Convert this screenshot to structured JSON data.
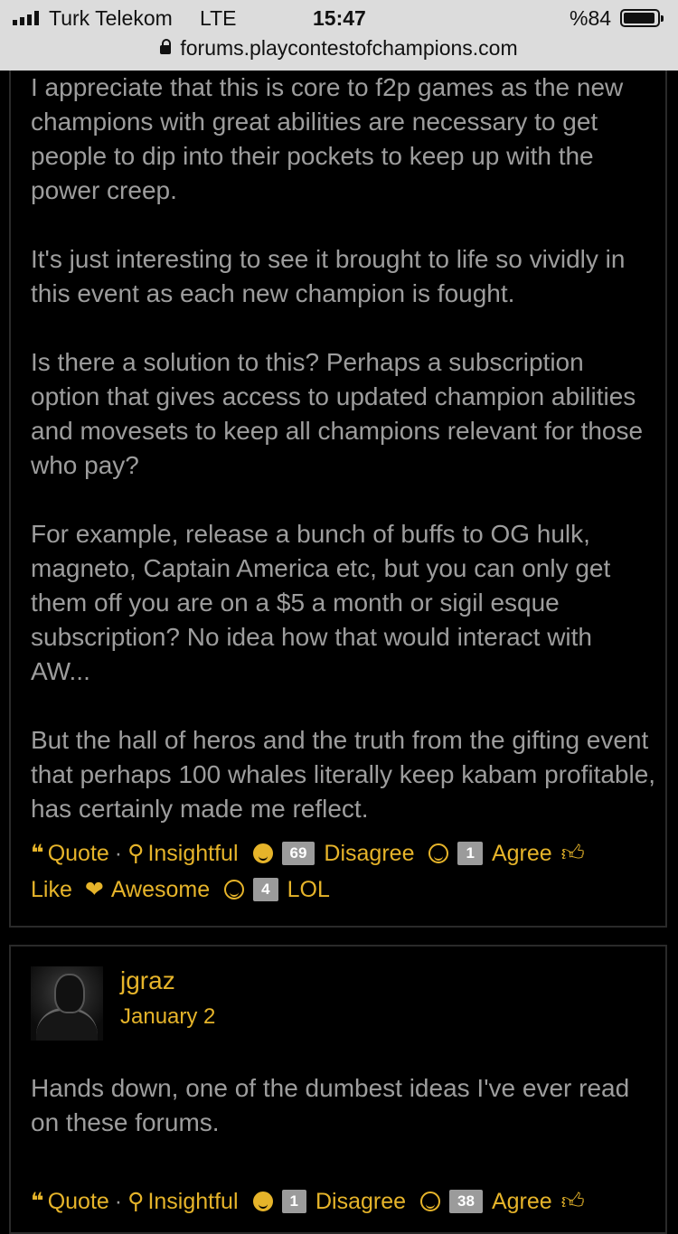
{
  "status_bar": {
    "carrier": "Turk Telekom",
    "network": "LTE",
    "time": "15:47",
    "battery": "%84"
  },
  "url_bar": {
    "url": "forums.playcontestofchampions.com"
  },
  "post1": {
    "paragraphs": [
      "I appreciate that this is core to f2p games as the new champions with great abilities are necessary to get people to dip into their pockets to keep up with the power creep.",
      "It's just interesting to see it brought to life so vividly in this event as each new champion is fought.",
      "Is there a solution to this? Perhaps a subscription option that gives access to updated champion abilities and movesets to keep all champions relevant for those who pay?",
      "For example, release a bunch of buffs to OG hulk, magneto, Captain America etc, but you can only get them off you are on a $5 a month or sigil esque subscription? No idea how that would interact with AW...",
      "But the hall of heros and the truth from the gifting event that perhaps 100 whales literally keep kabam profitable, has certainly made me reflect."
    ],
    "actions": {
      "quote": "Quote",
      "separator": "·",
      "insightful": "Insightful",
      "disagree_count": "69",
      "disagree": "Disagree",
      "agree_count": "1",
      "agree": "Agree",
      "like": "Like",
      "awesome": "Awesome",
      "lol_count": "4",
      "lol": "LOL"
    }
  },
  "post2": {
    "author": "jgraz",
    "date": "January 2",
    "body": "Hands down, one of the dumbest ideas I've ever read on these forums.",
    "actions": {
      "quote": "Quote",
      "separator": "·",
      "insightful": "Insightful",
      "disagree_count": "1",
      "disagree": "Disagree",
      "agree_count": "38",
      "agree": "Agree"
    }
  },
  "colors": {
    "accent": "#e6b42a",
    "text": "#9d9d9d",
    "background": "#000000",
    "badge": "#9b9b9b"
  }
}
